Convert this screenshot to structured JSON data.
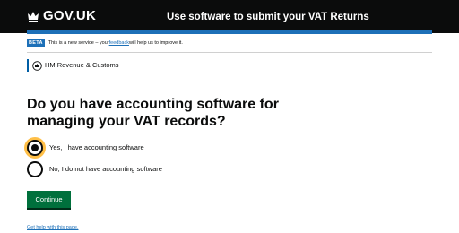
{
  "header": {
    "logo_text": "GOV.UK",
    "logo_icon": "crown-icon",
    "service_name": "Use software to submit your VAT Returns"
  },
  "phase_banner": {
    "tag": "BETA",
    "text_before": "This is a new service – your ",
    "link": "feedback",
    "text_after": " will help us to improve it."
  },
  "organisation": {
    "icon": "hmrc-crest-icon",
    "name": "HM Revenue & Customs"
  },
  "question": {
    "heading": "Do you have accounting software for managing your VAT records?",
    "options": [
      {
        "label": "Yes, I have accounting software",
        "selected": true
      },
      {
        "label": "No, I do not have accounting software",
        "selected": false
      }
    ]
  },
  "continue_label": "Continue",
  "help_link": "Get help with this page.",
  "colors": {
    "header_bg": "#0b0c0c",
    "accent_blue": "#1d70b8",
    "button_green": "#00703c",
    "focus_yellow": "#ffbf47"
  }
}
